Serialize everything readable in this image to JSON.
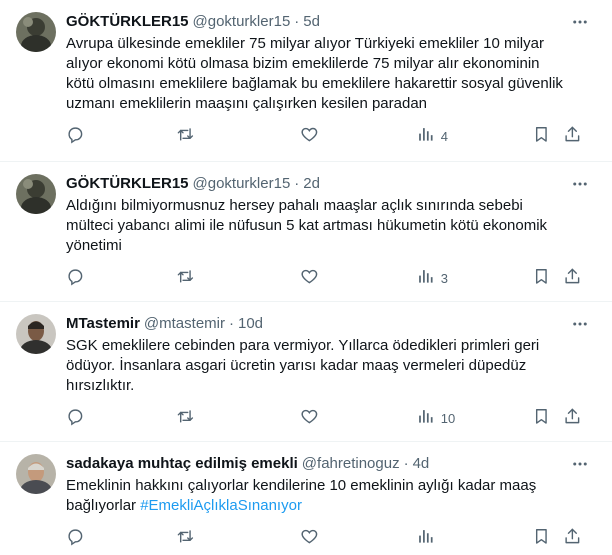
{
  "tweets": [
    {
      "name": "GÖKTÜRKLER15",
      "handle": "@gokturkler15",
      "sep": "·",
      "time": "5d",
      "text": "Avrupa ülkesinde emekliler 75 milyar alıyor Türkiyeki emekliler 10 milyar alıyor ekonomi kötü olmasa bizim emeklilerde 75 milyar alır ekonominin kötü olmasını emeklilere bağlamak bu emeklilere hakarettir sosyal güvenlik uzmanı emeklilerin maaşını çalışırken kesilen paradan",
      "hashtag": "",
      "views": "4",
      "avatar": "dark-grey-photo"
    },
    {
      "name": "GÖKTÜRKLER15",
      "handle": "@gokturkler15",
      "sep": "·",
      "time": "2d",
      "text": "Aldığını bilmiyormusnuz hersey pahalı maaşlar açlık sınırında sebebi mülteci yabancı alimi ile nüfusun 5 kat artması hükumetin kötü ekonomik yönetimi",
      "hashtag": "",
      "views": "3",
      "avatar": "dark-grey-photo"
    },
    {
      "name": "MTastemir",
      "handle": "@mtastemir",
      "sep": "·",
      "time": "10d",
      "text": "SGK emeklilere cebinden para vermiyor. Yıllarca ödedikleri primleri geri ödüyor. İnsanlara asgari ücretin yarısı kadar maaş vermeleri düpedüz hırsızlıktır.",
      "hashtag": "",
      "views": "10",
      "avatar": "person-photo"
    },
    {
      "name": "sadakaya muhtaç edilmiş emekli",
      "handle": "@fahretinoguz",
      "sep": "·",
      "time": "4d",
      "text": "Emeklinin hakkını çalıyorlar kendilerine 10 emeklinin aylığı kadar maaş bağlıyorlar ",
      "hashtag": "#EmekliAçlıklaSınanıyor",
      "views": "",
      "avatar": "person-photo"
    }
  ],
  "icons": {
    "reply": "reply-icon",
    "retweet": "retweet-icon",
    "like": "like-icon",
    "views": "views-icon",
    "bookmark": "bookmark-icon",
    "share": "share-icon",
    "more": "more-icon"
  },
  "colors": {
    "text": "#0f1419",
    "secondary": "#536471",
    "link": "#1d9bf0",
    "divider": "#eff3f4"
  }
}
